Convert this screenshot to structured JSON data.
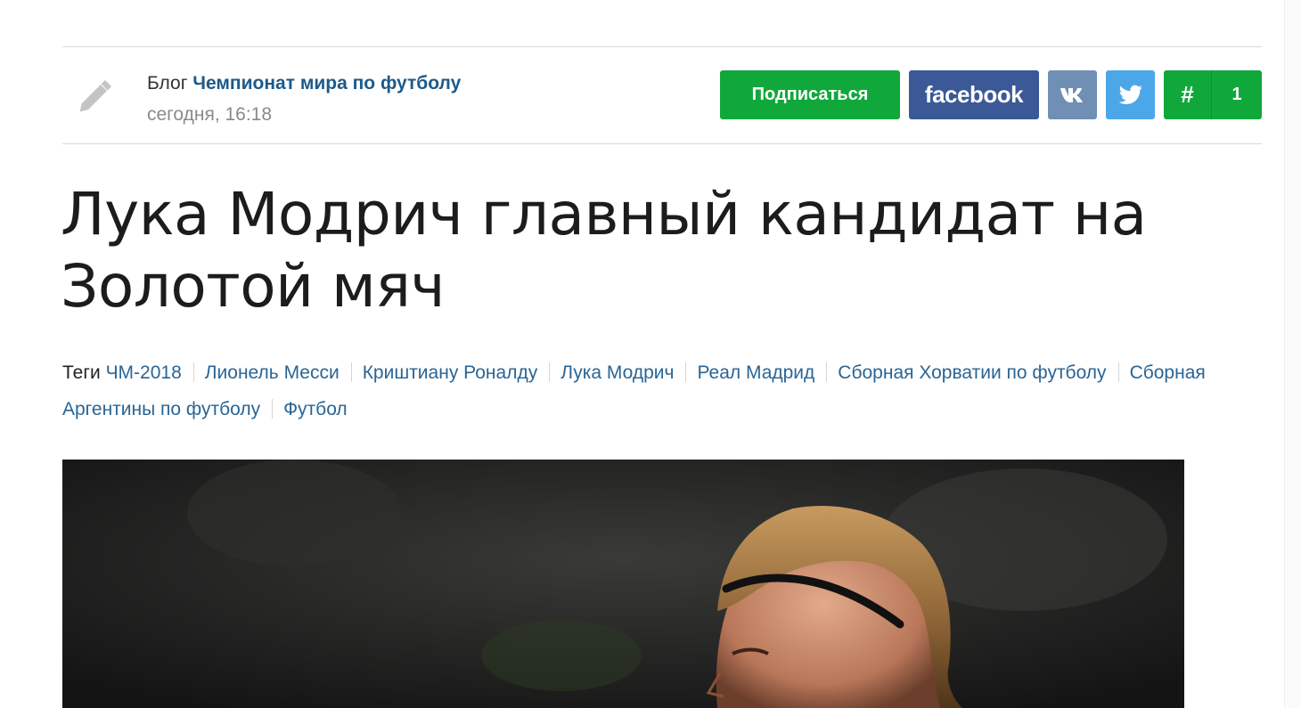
{
  "meta": {
    "blog_prefix": "Блог",
    "blog_name": "Чемпионат мира по футболу",
    "date": "сегодня, 16:18"
  },
  "share": {
    "subscribe_label": "Подписаться",
    "facebook_label": "facebook",
    "hash_label": "#",
    "count": "1"
  },
  "article": {
    "title": "Лука Модрич главный кандидат на Золотой мяч"
  },
  "tags": {
    "label": "Теги",
    "items": [
      "ЧМ-2018",
      "Лионель Месси",
      "Криштиану Роналду",
      "Лука Модрич",
      "Реал Мадрид",
      "Сборная Хорватии по футболу",
      "Сборная Аргентины по футболу",
      "Футбол"
    ]
  },
  "colors": {
    "subscribe": "#11a83b",
    "facebook": "#3b5897",
    "vk": "#6f8fb5",
    "twitter": "#4ca7e9",
    "link": "#2a6595"
  },
  "icons": {
    "author": "pencil-icon",
    "vk": "vk-icon",
    "twitter": "twitter-bird-icon"
  }
}
